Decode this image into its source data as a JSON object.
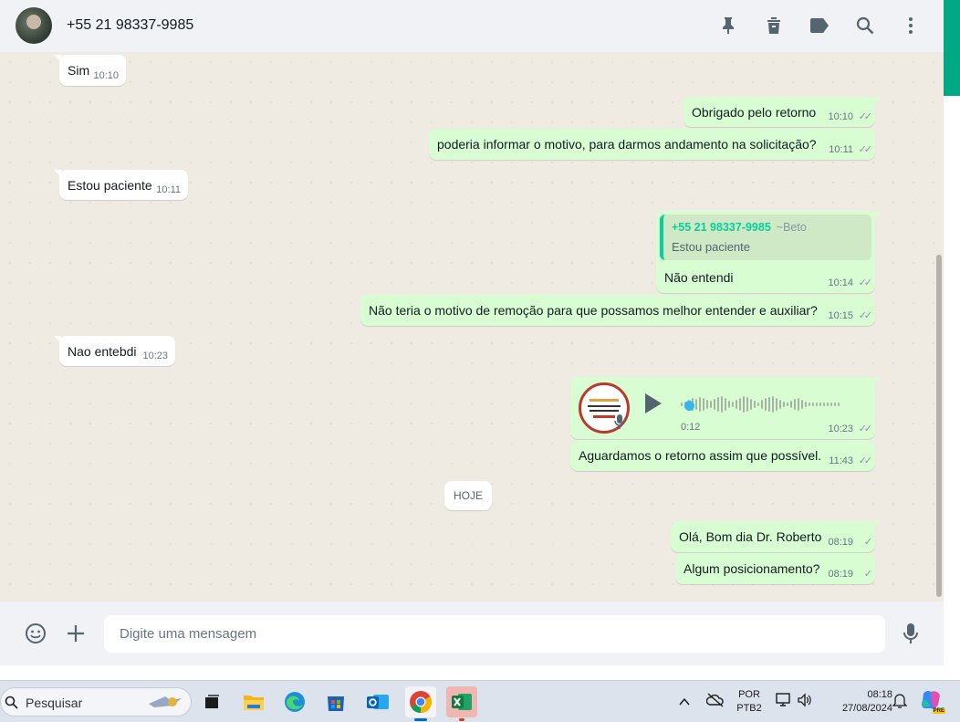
{
  "header": {
    "contact": "+55 21 98337-9985"
  },
  "messages": [
    {
      "dir": "in",
      "text": "Sim",
      "time": "10:10"
    },
    {
      "dir": "out",
      "text": "Obrigado pelo retorno",
      "time": "10:10"
    },
    {
      "dir": "out",
      "text": "poderia informar o motivo, para darmos andamento na solicitação?",
      "time": "10:11"
    },
    {
      "dir": "in",
      "text": "Estou paciente",
      "time": "10:11"
    },
    {
      "dir": "out",
      "quote_author": "+55 21 98337-9985",
      "quote_nick": "~Beto",
      "quote_text": "Estou paciente",
      "text": "Não entendi",
      "time": "10:14"
    },
    {
      "dir": "out",
      "text": "Não teria o motivo de remoção para que possamos melhor entender e auxiliar?",
      "time": "10:15"
    },
    {
      "dir": "in",
      "text": "Nao entebdi",
      "time": "10:23"
    },
    {
      "dir": "out",
      "type": "audio",
      "duration": "0:12",
      "time": "10:23"
    },
    {
      "dir": "out",
      "text": "Aguardamos o retorno assim que possível.",
      "time": "11:43"
    },
    {
      "dir": "out",
      "text": "Olá, Bom dia Dr. Roberto",
      "time": "08:19"
    },
    {
      "dir": "out",
      "text": "Algum posicionamento?",
      "time": "08:19"
    }
  ],
  "date_chip": "HOJE",
  "composer": {
    "placeholder": "Digite uma mensagem"
  },
  "taskbar": {
    "search": "Pesquisar",
    "lang": "POR",
    "layout": "PTB2",
    "time": "08:18",
    "date": "27/08/2024",
    "badge": "PRE"
  },
  "colors": {
    "accent": "#00a884",
    "incoming": "#ffffff",
    "outgoing": "#d9fdd3",
    "chat_bg": "#efeae2"
  }
}
